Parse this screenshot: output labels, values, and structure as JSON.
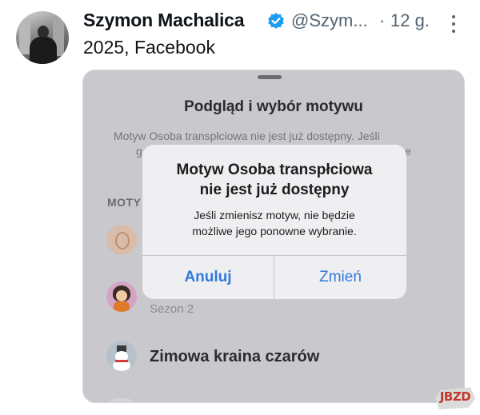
{
  "tweet": {
    "author_name": "Szymon Machalica",
    "handle": "@Szym...",
    "separator": "·",
    "time": "12 g.",
    "text": "2025, Facebook"
  },
  "sheet": {
    "title": "Podgląd i wybór motywu",
    "description_line1": "Motyw Osoba transpłciowa nie jest już dostępny. Jeśli",
    "description_line2_start": "g",
    "description_line2_end": "e",
    "section_label": "MOTY",
    "items": [
      {
        "icon": "swan-icon"
      },
      {
        "icon": "doll-icon",
        "subtitle": "Sezon 2"
      },
      {
        "icon": "snowman-icon",
        "name": "Zimowa kraina czarów"
      }
    ]
  },
  "alert": {
    "title_line1": "Motyw Osoba transpłciowa",
    "title_line2": "nie jest już dostępny",
    "message_line1": "Jeśli zmienisz motyw, nie będzie",
    "message_line2": "możliwe jego ponowne wybranie.",
    "cancel_label": "Anuluj",
    "confirm_label": "Zmień"
  },
  "watermark": {
    "text": "JBZD"
  },
  "colors": {
    "verified": "#1d9bf0",
    "alert_button": "#2f7bdc",
    "secondary_text": "#536471"
  }
}
